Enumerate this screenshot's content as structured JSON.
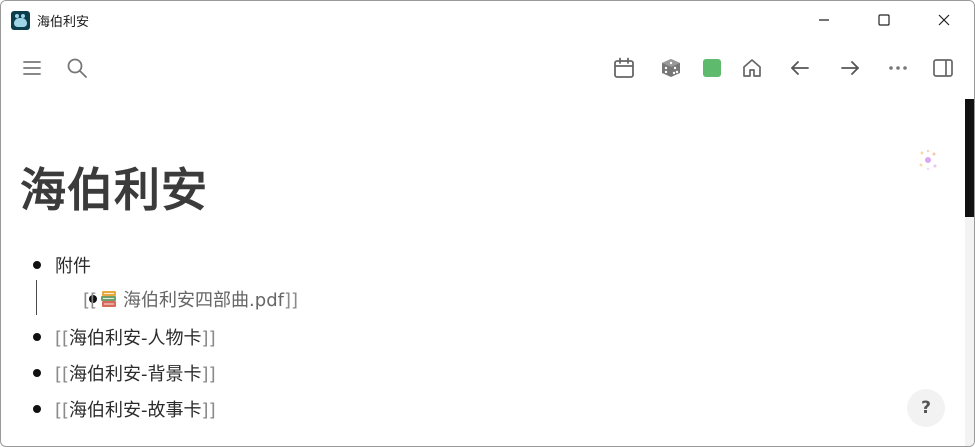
{
  "window": {
    "title": "海伯利安",
    "controls": [
      "minimize",
      "maximize",
      "close"
    ]
  },
  "toolbar": {
    "left_icons": [
      "menu-icon",
      "search-icon"
    ],
    "right_icons": [
      "calendar-icon",
      "dice-icon",
      "color-square-icon",
      "home-icon",
      "back-arrow-icon",
      "forward-arrow-icon",
      "more-icon",
      "sidebar-toggle-icon"
    ],
    "color_square": "#5ebb6e"
  },
  "page": {
    "title": "海伯利安",
    "items": [
      {
        "text": "附件"
      },
      {
        "open": "[[",
        "text": "海伯利安四部曲.pdf",
        "close": "]]",
        "icon": "books-icon"
      },
      {
        "open": "[[",
        "text": "海伯利安-人物卡",
        "close": "]]"
      },
      {
        "open": "[[",
        "text": "海伯利安-背景卡",
        "close": "]]"
      },
      {
        "open": "[[",
        "text": "海伯利安-故事卡",
        "close": "]]"
      }
    ]
  },
  "help_label": "?"
}
